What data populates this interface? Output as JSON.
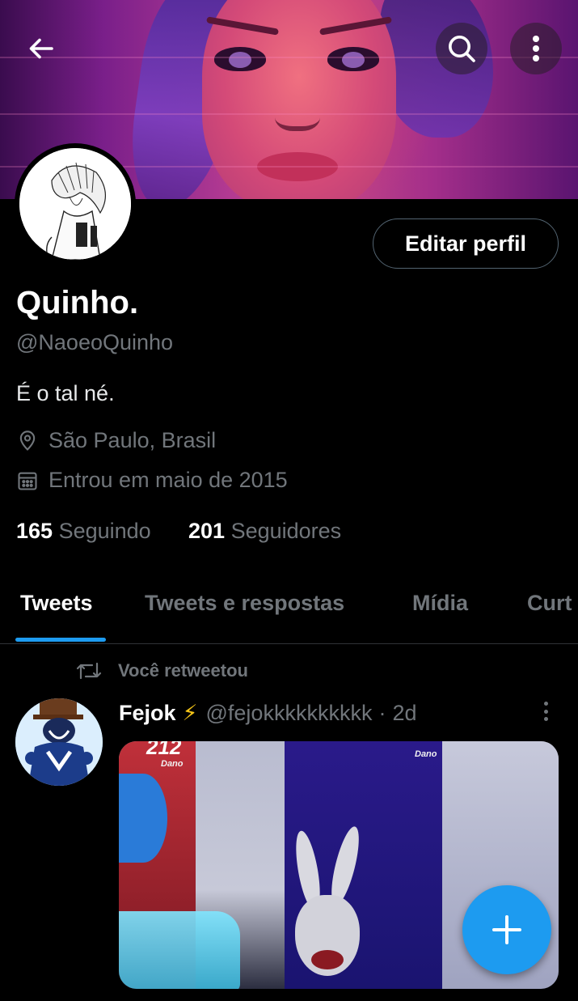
{
  "profile": {
    "name": "Quinho.",
    "handle": "@NaoeoQuinho",
    "bio": "É o tal né.",
    "location": "São Paulo, Brasil",
    "joined": "Entrou em maio de 2015",
    "following_count": "165",
    "following_label": "Seguindo",
    "followers_count": "201",
    "followers_label": "Seguidores",
    "edit_button": "Editar perfil"
  },
  "header": {
    "back_icon": "arrow-left-icon",
    "search_icon": "search-icon",
    "more_icon": "more-vertical-icon"
  },
  "tabs": [
    {
      "label": "Tweets",
      "active": true
    },
    {
      "label": "Tweets e respostas",
      "active": false
    },
    {
      "label": "Mídia",
      "active": false
    },
    {
      "label": "Curt",
      "active": false
    }
  ],
  "tweet": {
    "retweet_label": "Você retweetou",
    "author_name": "Fejok",
    "author_emoji": "⚡",
    "author_handle": "@fejokkkkkkkkkk",
    "separator": "·",
    "time": "2d",
    "media": {
      "left_score": "212",
      "left_label": "Dano",
      "right_label": "Dano"
    }
  },
  "fab": {
    "icon": "plus-icon"
  },
  "colors": {
    "accent": "#1d9bf0",
    "background": "#000000",
    "secondary_text": "#71767b"
  }
}
